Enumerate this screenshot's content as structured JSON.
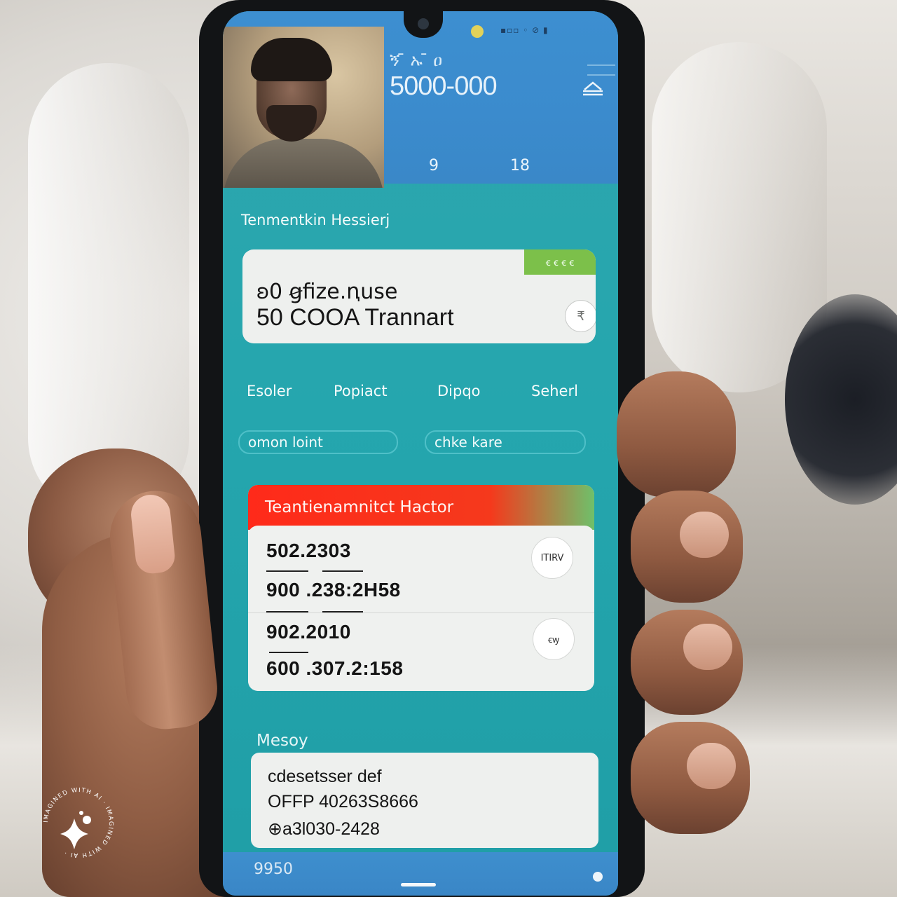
{
  "header": {
    "status_text": "▪▫▫ ◦ ⊘ ▮",
    "label": "ኝ ̄ ኡ ̄ ዐ",
    "balance": "5000-000",
    "stats": [
      "9",
      "18"
    ]
  },
  "section": {
    "title": "Tenmentkin Hessierj"
  },
  "card": {
    "badge": "ꞓ ꞓ ꞓ ꞓ",
    "line1": "ꞝ0 ꞡfize.ꞑuse",
    "line2": "50  COOA Trannart",
    "icon": "rupee-coin-icon"
  },
  "tabs": [
    "Esoler",
    "Popiact",
    "Dipqo",
    "Seherl"
  ],
  "inputs": {
    "left": "omon loint",
    "right": "chke kare"
  },
  "history": {
    "title": "Teantienamnitct Hactor",
    "rows": [
      "502.2303",
      "900 .238:2H58",
      "902.2010",
      "600 .307.2:158"
    ],
    "icons": [
      "badge-icon",
      "note-icon"
    ],
    "icon_text": [
      "ITIRV",
      "ꞓꝡ"
    ]
  },
  "memo": {
    "title": "Mesoy",
    "lines": [
      "cdesetsser def",
      "OFFP 40263S8666",
      "⊕a3l030-2428"
    ]
  },
  "footer": {
    "text": "9950"
  },
  "watermark": {
    "text": "IMAGINED WITH AI · IMAGINED WITH AI ·"
  },
  "colors": {
    "teal": "#25a6ae",
    "header_blue": "#3b8bcd",
    "alert_red": "#f5391c",
    "badge_green": "#7cc04a"
  }
}
